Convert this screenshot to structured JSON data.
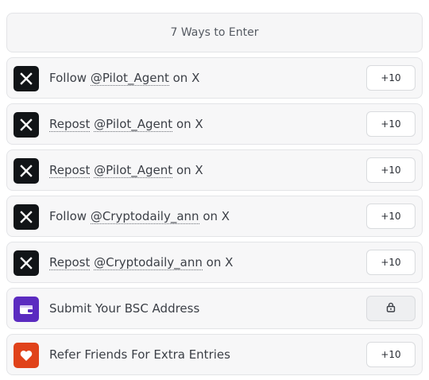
{
  "header": {
    "title": "7 Ways to Enter"
  },
  "entries": [
    {
      "pre": "Follow ",
      "handle": "@Pilot_Agent",
      "post": " on X",
      "points": "+10"
    },
    {
      "pre": "Repost",
      "handle": "@Pilot_Agent",
      "post": " on X",
      "points": "+10"
    },
    {
      "pre": "Repost",
      "handle": "@Pilot_Agent",
      "post": " on X",
      "points": "+10"
    },
    {
      "pre": "Follow ",
      "handle": "@Cryptodaily_ann",
      "post": " on X",
      "points": "+10"
    },
    {
      "pre": "Repost",
      "handle": "@Cryptodaily_ann",
      "post": " on X",
      "points": "+10"
    },
    {
      "label": "Submit Your BSC Address"
    },
    {
      "label": "Refer Friends For Extra Entries",
      "points": "+10"
    }
  ],
  "icons": {
    "x": "x-logo-icon",
    "wallet": "wallet-icon",
    "heart": "heart-icon",
    "lock": "lock-icon"
  },
  "colors": {
    "x_brand": "#111417",
    "wallet_accent": "#5b2bc0",
    "heart_accent": "#e0421a"
  }
}
